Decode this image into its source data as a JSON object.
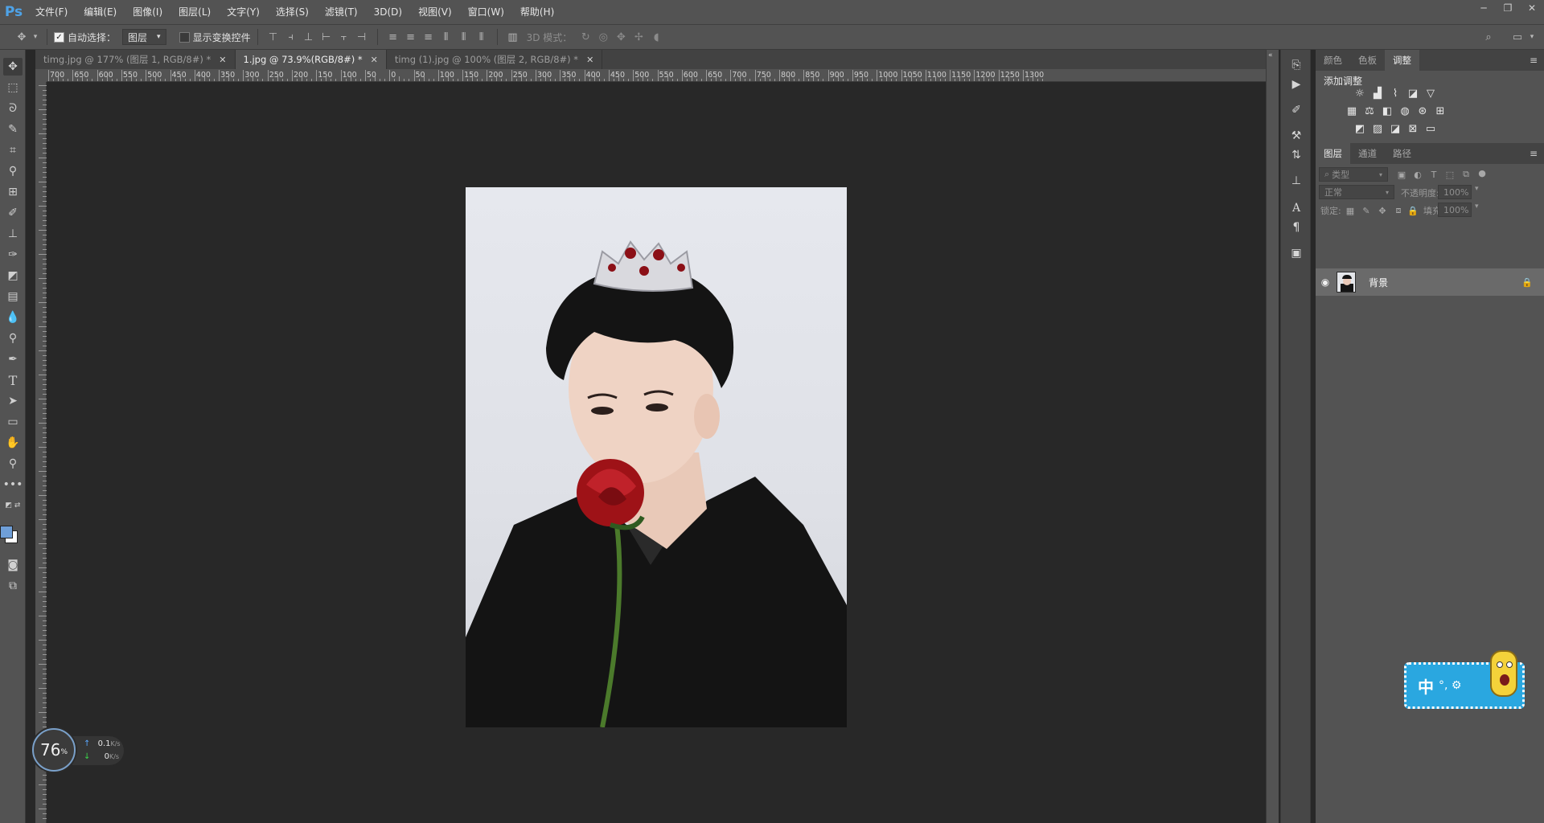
{
  "app": {
    "logo": "Ps",
    "menu": [
      "文件(F)",
      "编辑(E)",
      "图像(I)",
      "图层(L)",
      "文字(Y)",
      "选择(S)",
      "滤镜(T)",
      "3D(D)",
      "视图(V)",
      "窗口(W)",
      "帮助(H)"
    ],
    "window_controls": [
      "─",
      "❐",
      "✕"
    ]
  },
  "options": {
    "auto_select_label": "自动选择：",
    "auto_select_checked": true,
    "auto_select_target": "图层",
    "show_transform_label": "显示变换控件",
    "show_transform_checked": false,
    "mode_3d_label": "3D 模式："
  },
  "tabs": [
    {
      "label": "timg.jpg @ 177% (图层 1, RGB/8#) *",
      "active": false
    },
    {
      "label": "1.jpg @ 73.9%(RGB/8#) *",
      "active": true
    },
    {
      "label": "timg (1).jpg @ 100% (图层 2, RGB/8#) *",
      "active": false
    }
  ],
  "ruler": {
    "top_labels": [
      "700",
      "650",
      "600",
      "550",
      "500",
      "450",
      "400",
      "350",
      "300",
      "250",
      "200",
      "150",
      "100",
      "50",
      "0",
      "50",
      "100",
      "150",
      "200",
      "250",
      "300",
      "350",
      "400",
      "450",
      "500",
      "550",
      "600",
      "650",
      "700",
      "750",
      "800",
      "850",
      "900",
      "950",
      "1000",
      "1050",
      "1100",
      "1150",
      "1200",
      "1250",
      "1300"
    ]
  },
  "panels": {
    "top_tabs": [
      "颜色",
      "色板",
      "调整"
    ],
    "top_active": 2,
    "add_adjustment": "添加调整",
    "layer_tabs": [
      "图层",
      "通道",
      "路径"
    ],
    "layer_active": 0,
    "filter_kind": "类型",
    "blend_mode": "正常",
    "opacity_label": "不透明度:",
    "opacity_value": "100%",
    "lock_label": "锁定:",
    "fill_label": "填充:",
    "fill_value": "100%",
    "layers": [
      {
        "name": "背景",
        "visible": true,
        "locked": true
      }
    ]
  },
  "speed_widget": {
    "percent": "76",
    "percent_unit": "%",
    "up": "0.1",
    "up_unit": "K/s",
    "down": "0",
    "down_unit": "K/s"
  },
  "ime": {
    "char": "中",
    "symbols": "°, ⚙"
  },
  "colors": {
    "accent": "#4ea3e8",
    "foreground_swatch": "#6f9fd8",
    "background_swatch": "#ffffff"
  }
}
